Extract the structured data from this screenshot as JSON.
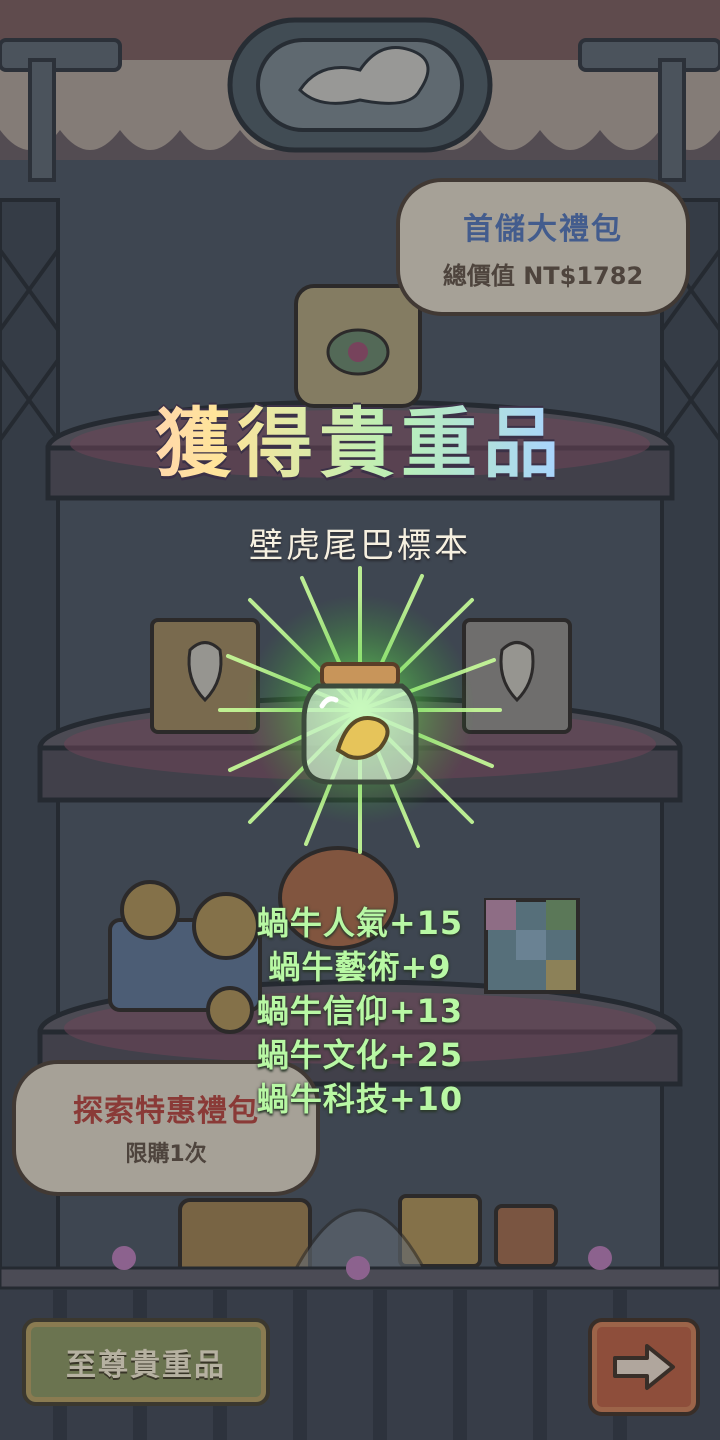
{
  "promo_top": {
    "title": "首儲大禮包",
    "subtitle": "總價值 NT$1782"
  },
  "promo_left": {
    "title": "探索特惠禮包",
    "subtitle": "限購1次"
  },
  "popup": {
    "title": "獲得貴重品",
    "item_name": "壁虎尾巴標本",
    "item_icon": "specimen-jar-icon",
    "stats": [
      "蝸牛人氣+15",
      "蝸牛藝術+9",
      "蝸牛信仰+13",
      "蝸牛文化+25",
      "蝸牛科技+10"
    ]
  },
  "buttons": {
    "premium_label": "至尊貴重品",
    "next_icon": "arrow-right-icon"
  },
  "colors": {
    "stat_text": "#b8f8a4",
    "glow": "#7dff5a",
    "background": "#4f5863"
  }
}
